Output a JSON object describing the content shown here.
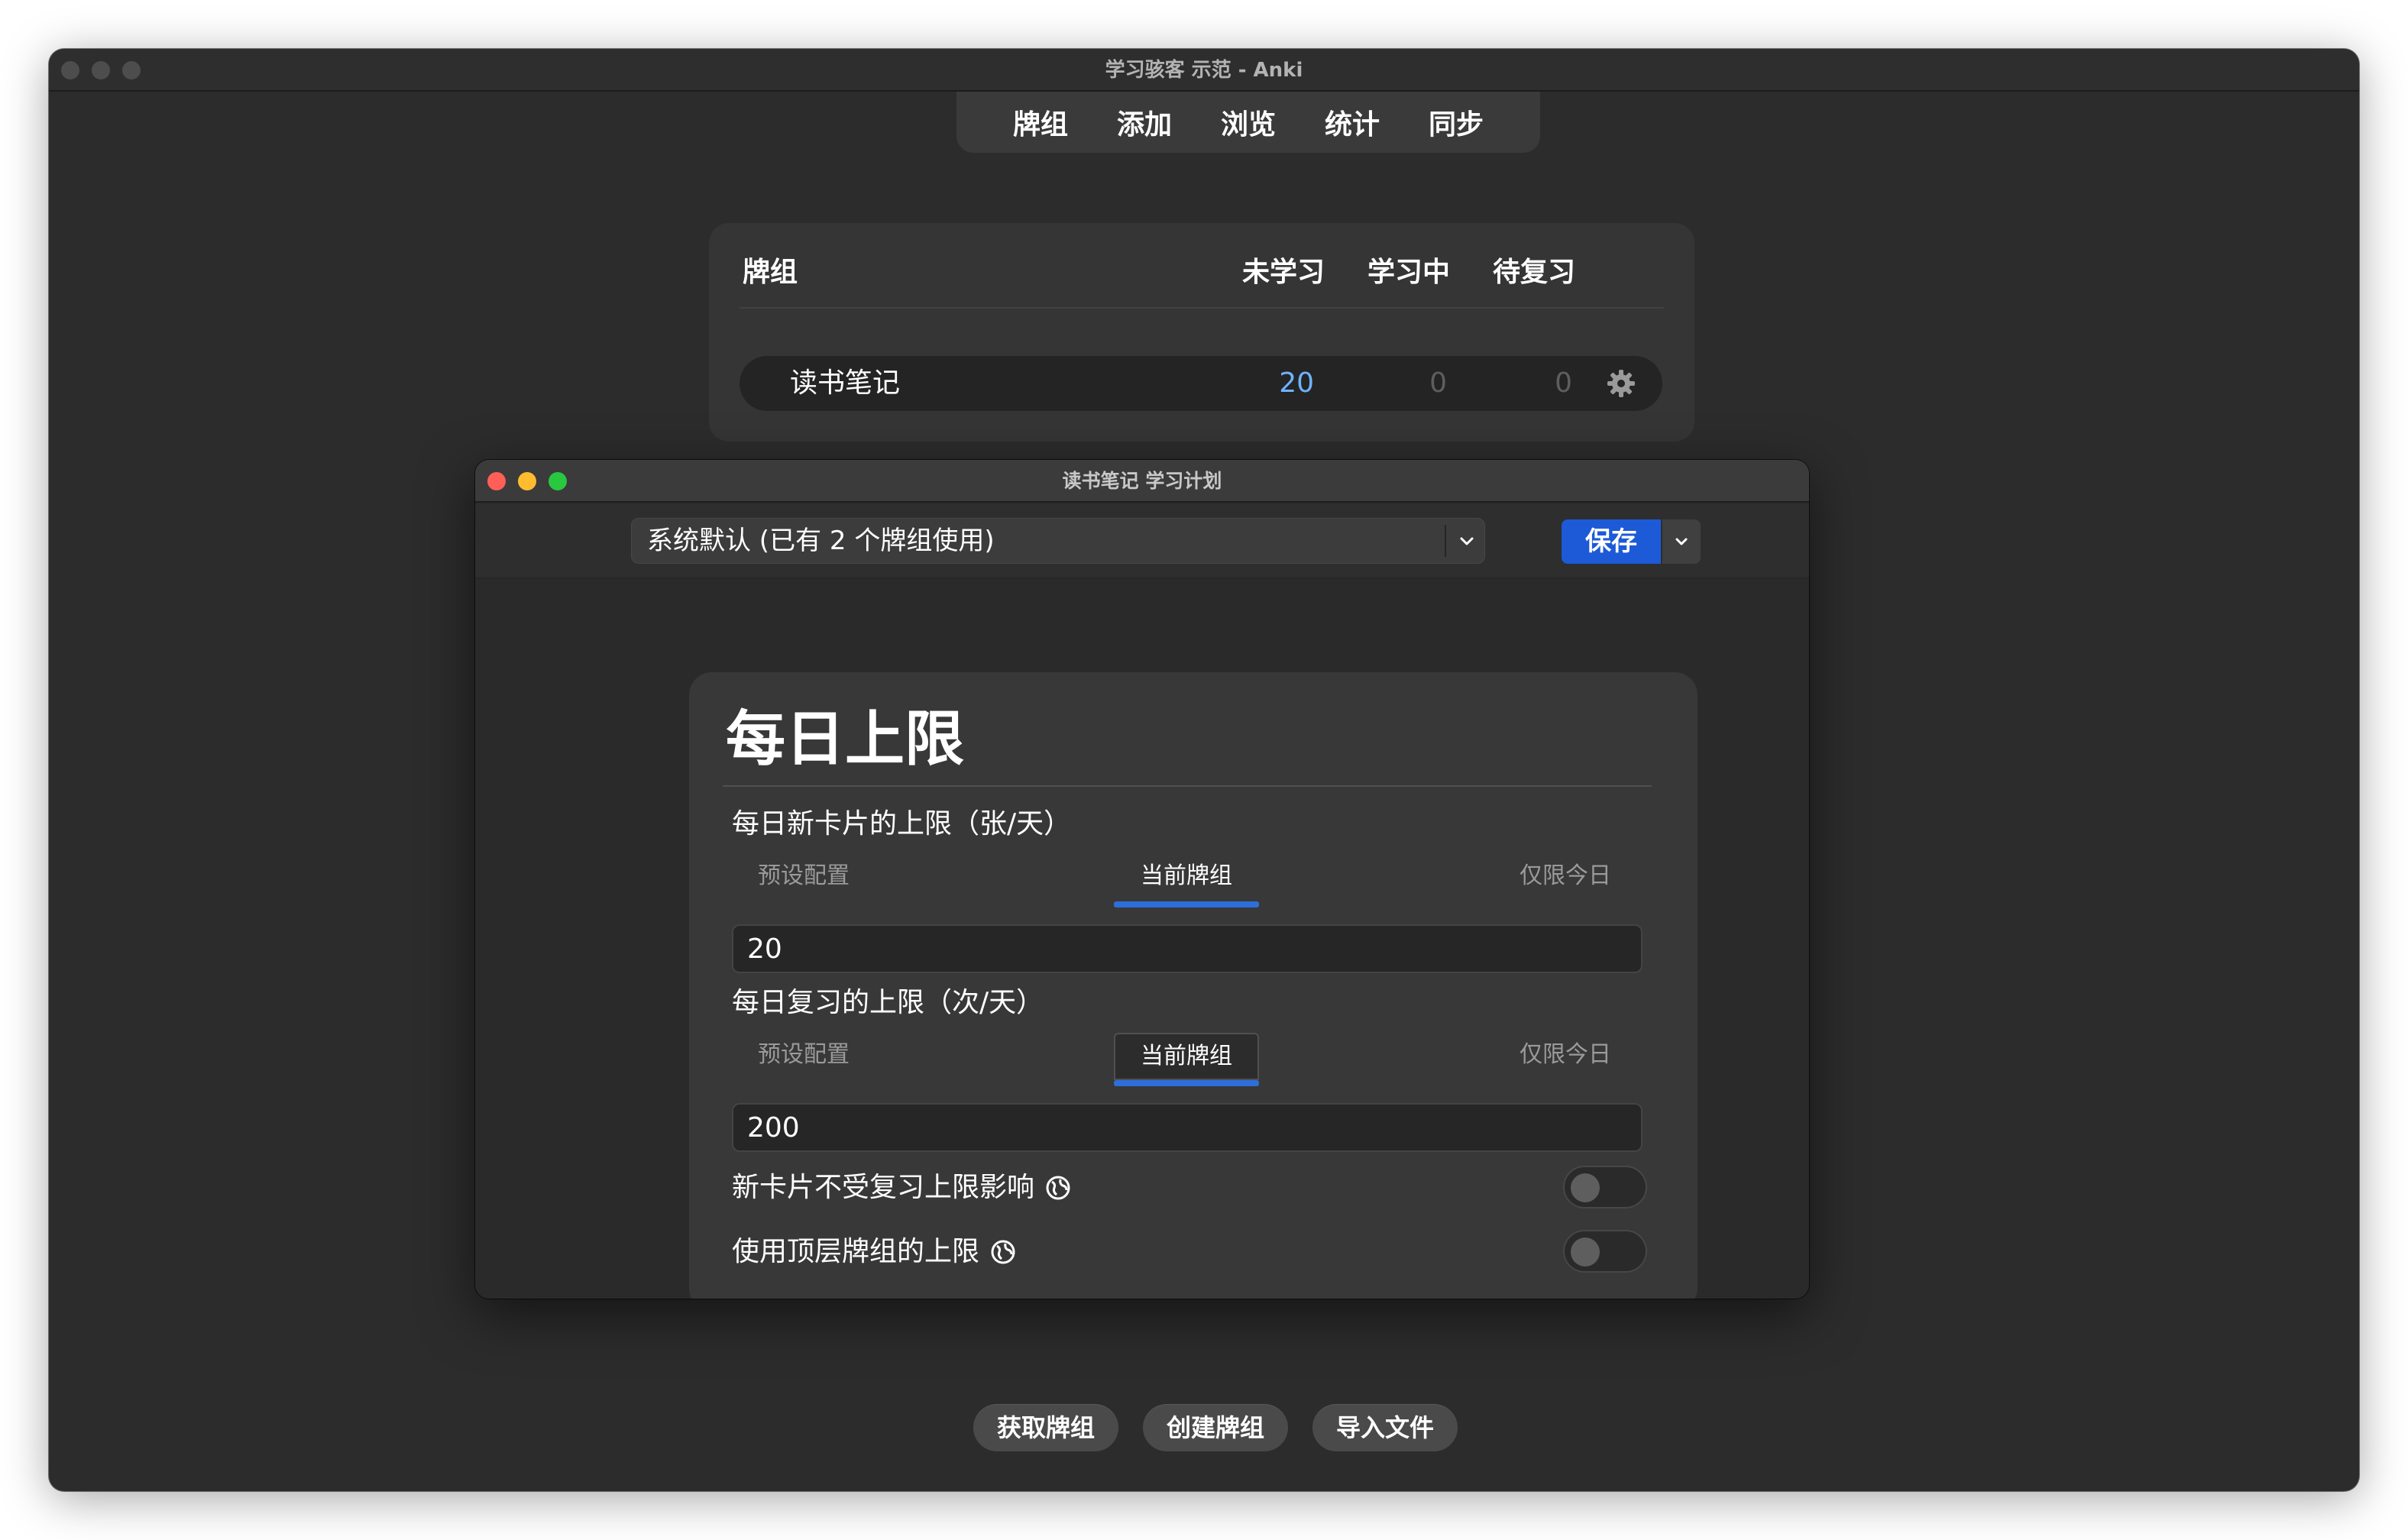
{
  "window": {
    "title": "学习骇客 示范 - Anki"
  },
  "toolbar": {
    "items": [
      "牌组",
      "添加",
      "浏览",
      "统计",
      "同步"
    ]
  },
  "deck_list": {
    "headers": {
      "deck": "牌组",
      "new": "未学习",
      "learning": "学习中",
      "review": "待复习"
    },
    "rows": [
      {
        "name": "读书笔记",
        "new": "20",
        "learning": "0",
        "review": "0"
      }
    ],
    "colors": {
      "new_count": "#6fb3ff",
      "zero_count": "#5e5e5e"
    }
  },
  "options_window": {
    "title": "读书笔记 学习计划",
    "preset": {
      "selected": "系统默认 (已有 2 个牌组使用)"
    },
    "save_label": "保存",
    "section": {
      "title": "每日上限",
      "new_limit": {
        "label": "每日新卡片的上限（张/天）",
        "tabs": [
          "预设配置",
          "当前牌组",
          "仅限今日"
        ],
        "active_tab": "当前牌组",
        "value": "20"
      },
      "review_limit": {
        "label": "每日复习的上限（次/天）",
        "tabs": [
          "预设配置",
          "当前牌组",
          "仅限今日"
        ],
        "active_tab": "当前牌组",
        "value": "200"
      },
      "toggles": [
        {
          "label": "新卡片不受复习上限影响",
          "on": false,
          "icon": "globe-icon"
        },
        {
          "label": "使用顶层牌组的上限",
          "on": false,
          "icon": "globe-icon"
        }
      ]
    },
    "accent_color": "#1d5ad7",
    "traffic_colors": [
      "#ff5f57",
      "#febc2e",
      "#28c840"
    ]
  },
  "bottom_buttons": [
    "获取牌组",
    "创建牌组",
    "导入文件"
  ]
}
